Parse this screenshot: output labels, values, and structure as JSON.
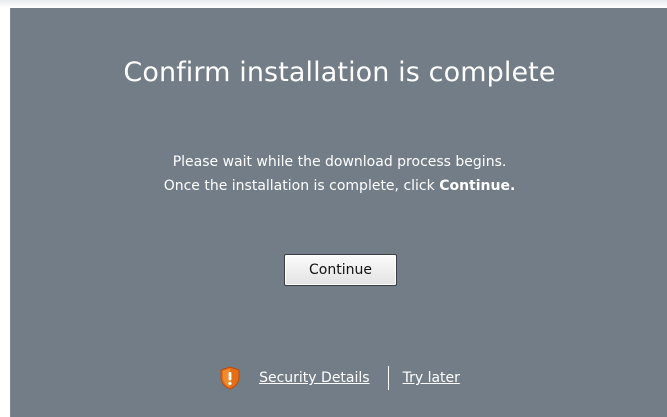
{
  "dialog": {
    "title": "Confirm installation is complete",
    "message_line1": "Please wait while the download process begins.",
    "message_line2_prefix": "Once the installation is complete, click ",
    "message_line2_bold": "Continue.",
    "continue_label": "Continue"
  },
  "footer": {
    "security_icon": "shield-warning-icon",
    "security_details_label": "Security Details",
    "try_later_label": "Try later"
  },
  "colors": {
    "panel_background": "#737d87",
    "text": "#ffffff",
    "shield_orange": "#e56d16"
  }
}
